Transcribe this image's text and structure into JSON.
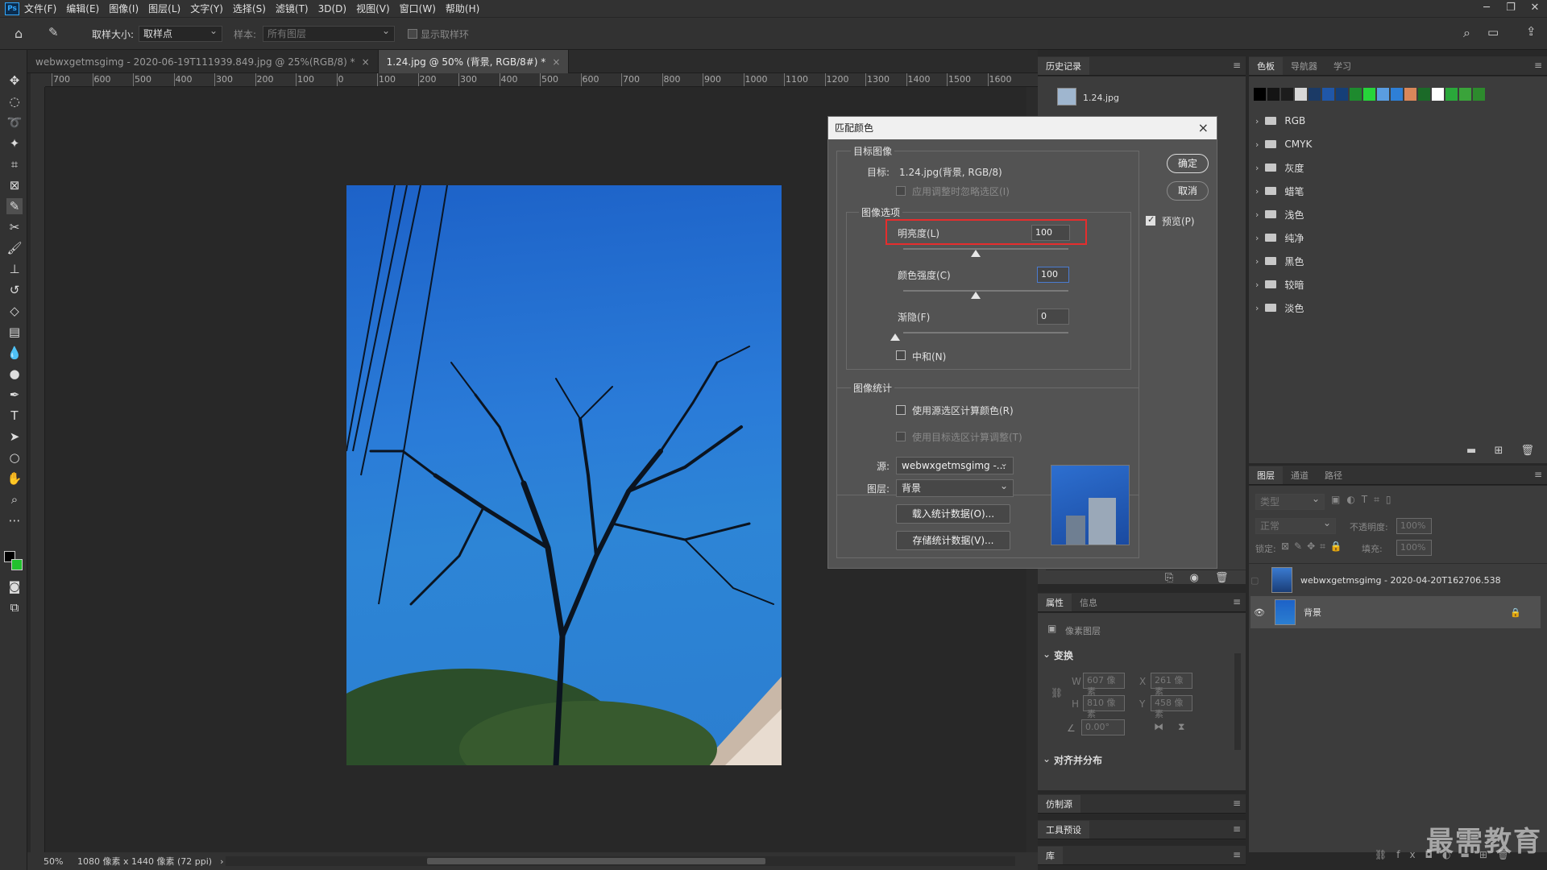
{
  "app": {
    "logo": "Ps"
  },
  "menu": [
    "文件(F)",
    "编辑(E)",
    "图像(I)",
    "图层(L)",
    "文字(Y)",
    "选择(S)",
    "滤镜(T)",
    "3D(D)",
    "视图(V)",
    "窗口(W)",
    "帮助(H)"
  ],
  "options": {
    "sample_size_label": "取样大小:",
    "sample_size_value": "取样点",
    "sample_label": "样本:",
    "sample_value": "所有图层",
    "show_ring": "显示取样环"
  },
  "doc_tabs": [
    {
      "label": "webwxgetmsgimg - 2020-06-19T111939.849.jpg @ 25%(RGB/8) *",
      "close": "×"
    },
    {
      "label": "1.24.jpg @ 50% (背景, RGB/8#) *",
      "close": "×"
    }
  ],
  "ruler_h": [
    "700",
    "600",
    "500",
    "400",
    "300",
    "200",
    "100",
    "0",
    "100",
    "200",
    "300",
    "400",
    "500",
    "600",
    "700",
    "800",
    "900",
    "1000",
    "1100",
    "1200",
    "1300",
    "1400",
    "1500",
    "1600"
  ],
  "status": {
    "zoom": "50%",
    "info": "1080 像素 x 1440 像素 (72 ppi)",
    "arrow": "›"
  },
  "history": {
    "tab": "历史记录",
    "item": "1.24.jpg"
  },
  "swatches_panel": {
    "tabs": [
      "色板",
      "导航器",
      "学习"
    ],
    "colors": [
      "#000000",
      "#141414",
      "#1c1c1c",
      "#d8d8d8",
      "#1b3a66",
      "#2057a8",
      "#153f78",
      "#1e8a2e",
      "#27d43a",
      "#5a9de0",
      "#2e7fd6",
      "#d9875a",
      "#1b6a28",
      "#ffffff",
      "#2aa83a",
      "#3aa33a",
      "#2d8a2d"
    ],
    "folders": [
      "RGB",
      "CMYK",
      "灰度",
      "蜡笔",
      "浅色",
      "纯净",
      "黑色",
      "较暗",
      "淡色"
    ]
  },
  "layers_panel": {
    "tabs": [
      "图层",
      "通道",
      "路径"
    ],
    "search": "类型",
    "blend": "正常",
    "opacity_label": "不透明度:",
    "opacity": "100%",
    "lock_label": "锁定:",
    "fill_label": "填充:",
    "fill": "100%",
    "layers": [
      "webwxgetmsgimg - 2020-04-20T162706.538",
      "背景"
    ]
  },
  "properties": {
    "tabs": [
      "属性",
      "信息"
    ],
    "type": "像素图层",
    "transform": "变换",
    "w_label": "W",
    "w": "607 像素",
    "x_label": "X",
    "x": "261 像素",
    "h_label": "H",
    "h": "810 像素",
    "y_label": "Y",
    "y": "458 像素",
    "angle": "0.00°",
    "align": "对齐并分布"
  },
  "collapsed_panels": [
    "仿制源",
    "工具预设",
    "库"
  ],
  "dialog": {
    "title": "匹配颜色",
    "close": "×",
    "target_group": "目标图像",
    "target_label": "目标:",
    "target_value": "1.24.jpg(背景, RGB/8)",
    "ignore_sel": "应用调整时忽略选区(I)",
    "options_group": "图像选项",
    "luminance_label": "明亮度(L)",
    "luminance": "100",
    "intensity_label": "颜色强度(C)",
    "intensity": "100",
    "fade_label": "渐隐(F)",
    "fade": "0",
    "neutralize": "中和(N)",
    "ok": "确定",
    "cancel": "取消",
    "preview": "预览(P)",
    "stats_group": "图像统计",
    "use_src_sel": "使用源选区计算颜色(R)",
    "use_tgt_sel": "使用目标选区计算调整(T)",
    "source_label": "源:",
    "source_value": "webwxgetmsgimg -...",
    "layer_label": "图层:",
    "layer_value": "背景",
    "load_stats": "载入统计数据(O)...",
    "save_stats": "存储统计数据(V)..."
  },
  "watermark": "最需教育"
}
